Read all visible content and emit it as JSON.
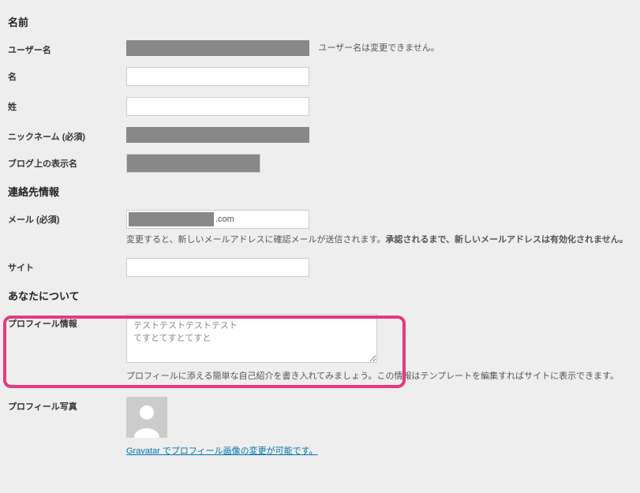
{
  "sections": {
    "name": "名前",
    "contact": "連絡先情報",
    "about": "あなたについて"
  },
  "fields": {
    "username": {
      "label": "ユーザー名",
      "hint": "ユーザー名は変更できません。"
    },
    "first_name": {
      "label": "名"
    },
    "last_name": {
      "label": "姓"
    },
    "nickname": {
      "label": "ニックネーム (必須)"
    },
    "display_name": {
      "label": "ブログ上の表示名"
    },
    "email": {
      "label": "メール (必須)",
      "domain_visible": ".com",
      "desc_pre": "変更すると、新しいメールアドレスに確認メールが送信されます。",
      "desc_bold": "承認されるまで、新しいメールアドレスは有効化されません。"
    },
    "website": {
      "label": "サイト"
    },
    "bio": {
      "label": "プロフィール情報",
      "value": "テストテストテストテスト\nてすとてすとてすと",
      "desc": "プロフィールに添える簡単な自己紹介を書き入れてみましょう。この情報はテンプレートを編集すればサイトに表示できます。"
    },
    "photo": {
      "label": "プロフィール写真",
      "link": "Gravatar でプロフィール画像の変更が可能です。"
    }
  }
}
